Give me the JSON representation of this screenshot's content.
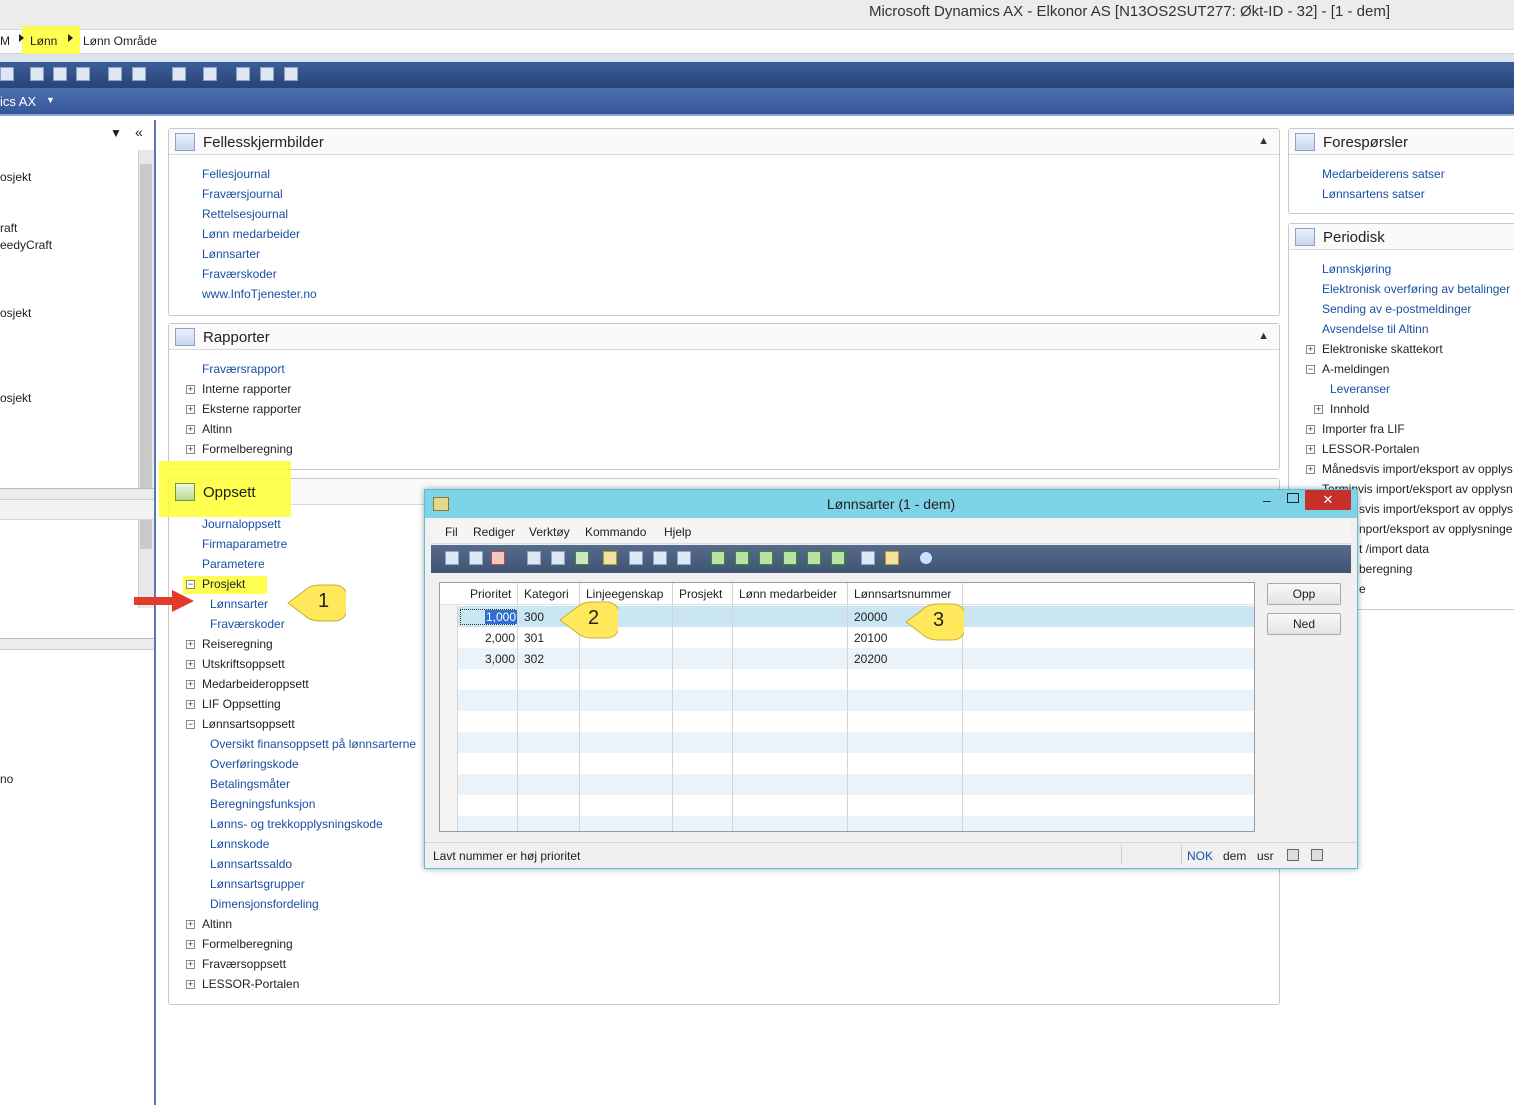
{
  "window": {
    "title": "Microsoft Dynamics AX - Elkonor AS [N13OS2SUT277: Økt-ID - 32] - [1 - dem]"
  },
  "breadcrumb": {
    "root": "M",
    "item1": "Lønn",
    "item2": "Lønn Område"
  },
  "axbar": {
    "label": "ics AX"
  },
  "leftpane": {
    "rows": [
      "osjekt",
      "raft",
      "eedyCraft",
      "osjekt",
      "osjekt",
      "no"
    ]
  },
  "fellesskjermbilder": {
    "title": "Fellesskjermbilder",
    "links": [
      "Fellesjournal",
      "Fraværsjournal",
      "Rettelsesjournal",
      "Lønn medarbeider",
      "Lønnsarter",
      "Fraværskoder",
      "www.InfoTjenester.no"
    ]
  },
  "rapporter": {
    "title": "Rapporter",
    "link": "Fraværsrapport",
    "groups": [
      "Interne rapporter",
      "Eksterne rapporter",
      "Altinn",
      "Formelberegning"
    ]
  },
  "oppsett": {
    "title": "Oppsett",
    "links": [
      "Journaloppsett",
      "Firmaparametre",
      "Parametere"
    ],
    "prosjekt": "Prosjekt",
    "prosjekt_children": [
      "Lønnsarter",
      "Fraværskoder"
    ],
    "groups1": [
      "Reiseregning",
      "Utskriftsoppsett",
      "Medarbeideroppsett",
      "LIF Oppsetting"
    ],
    "lonnsartsoppsett": "Lønnsartsoppsett",
    "lonnsartsoppsett_children": [
      "Oversikt finansoppsett på lønnsarterne",
      "Overføringskode",
      "Betalingsmåter",
      "Beregningsfunksjon",
      "Lønns- og trekkopplysningskode",
      "Lønnskode",
      "Lønnsartssaldo",
      "Lønnsartsgrupper",
      "Dimensjonsfordeling"
    ],
    "groups2": [
      "Altinn",
      "Formelberegning",
      "Fraværsoppsett",
      "LESSOR-Portalen"
    ]
  },
  "foresporsler": {
    "title": "Forespørsler",
    "links": [
      "Medarbeiderens satser",
      "Lønnsartens satser"
    ]
  },
  "periodisk": {
    "title": "Periodisk",
    "links": [
      "Lønnskjøring",
      "Elektronisk overføring av betalinger",
      "Sending av e-postmeldinger",
      "Avsendelse til Altinn"
    ],
    "elektroniske": "Elektroniske skattekort",
    "ameldingen": "A-meldingen",
    "leveranser": "Leveranser",
    "innhold": "Innhold",
    "groups": [
      "Importer fra LIF",
      "LESSOR-Portalen",
      "Månedsvis import/eksport av opplys",
      "Terminvis import/eksport av opplysn",
      "svis import/eksport av opplys",
      "nport/eksport av opplysninge",
      "t /import data",
      "beregning",
      "e"
    ]
  },
  "dialog": {
    "title": "Lønnsarter (1 - dem)",
    "menu": [
      "Fil",
      "Rediger",
      "Verktøy",
      "Kommando",
      "Hjelp"
    ],
    "columns": [
      "Prioritet",
      "Kategori",
      "Linjeegenskap",
      "Prosjekt",
      "Lønn medarbeider",
      "Lønnsartsnummer"
    ],
    "rows": [
      {
        "prioritet": "1,000",
        "kategori": "300",
        "lonnsartsnummer": "20000"
      },
      {
        "prioritet": "2,000",
        "kategori": "301",
        "lonnsartsnummer": "20100"
      },
      {
        "prioritet": "3,000",
        "kategori": "302",
        "lonnsartsnummer": "20200"
      }
    ],
    "buttons": {
      "up": "Opp",
      "down": "Ned"
    },
    "status": {
      "text": "Lavt nummer er høj prioritet",
      "currency": "NOK",
      "company": "dem",
      "user": "usr"
    }
  },
  "callouts": [
    "1",
    "2",
    "3"
  ],
  "colors": {
    "highlight": "#ffff33",
    "link": "#1a4fa3",
    "dialog_title": "#7fd3e6",
    "close": "#c7302a"
  }
}
